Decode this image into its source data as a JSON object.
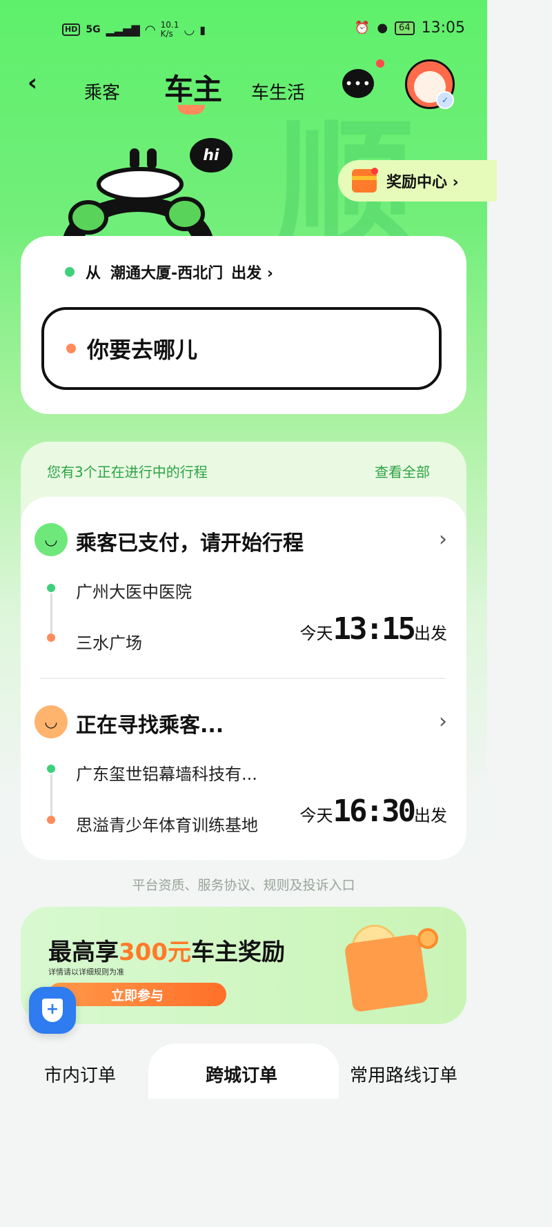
{
  "status_bar": {
    "hd": "HD",
    "network": "5G",
    "speed_value": "10.1",
    "speed_unit": "K/s",
    "battery": "64",
    "time": "13:05"
  },
  "nav": {
    "tabs": [
      "乘客",
      "车主",
      "车生活"
    ],
    "active_tab": "车主",
    "chat_icon_text": "•••"
  },
  "mascot": {
    "bubble": "hi"
  },
  "reward_center": {
    "label": "奖励中心 ›"
  },
  "address": {
    "from_prefix": "从",
    "from_place": "潮通大厦-西北门",
    "from_suffix": "出发 ›",
    "destination_placeholder": "你要去哪儿"
  },
  "trips": {
    "summary": "您有3个正在进行中的行程",
    "view_all": "查看全部",
    "items": [
      {
        "status": "乘客已支付，请开始行程",
        "from": "广州大医中医院",
        "to": "三水广场",
        "day": "今天",
        "time": "13:15",
        "suffix": "出发"
      },
      {
        "status": "正在寻找乘客...",
        "from": "广东玺世铝幕墙科技有...",
        "to": "思溢青少年体育训练基地",
        "day": "今天",
        "time": "16:30",
        "suffix": "出发"
      }
    ]
  },
  "footer_note": "平台资质、服务协议、规则及投诉入口",
  "banner": {
    "title_prefix": "最高享",
    "title_highlight": "300元",
    "title_suffix": "车主奖励",
    "subtitle": "详情请以详细规则为准",
    "button": "立即参与"
  },
  "bottom_tabs": {
    "items": [
      "市内订单",
      "跨城订单",
      "常用路线订单"
    ],
    "active": "跨城订单"
  },
  "colors": {
    "brand_green": "#5ef06b",
    "accent_orange": "#ff7a2a",
    "text_green": "#2ca344",
    "shield_blue": "#2f7bf0"
  }
}
